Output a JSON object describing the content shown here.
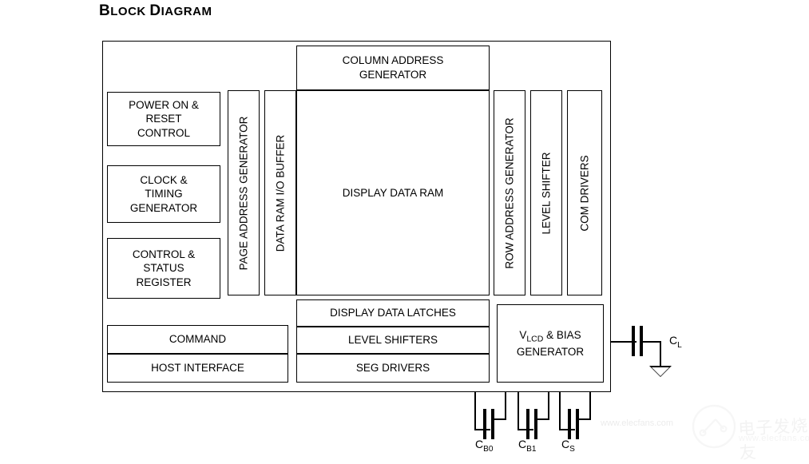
{
  "page": {
    "title_main": "B",
    "title": "Block Diagram",
    "title_parts": [
      "B",
      "LOCK ",
      "D",
      "IAGRAM"
    ]
  },
  "diagram": {
    "left_blocks": [
      {
        "label": "POWER ON &\nRESET\nCONTROL"
      },
      {
        "label": "CLOCK &\nTIMING\nGENERATOR"
      },
      {
        "label": "CONTROL &\nSTATUS\nREGISTER"
      }
    ],
    "bottom_left_blocks": [
      {
        "label": "COMMAND"
      },
      {
        "label": "HOST INTERFACE"
      }
    ],
    "vertical_blocks": [
      {
        "label": "PAGE ADDRESS GENERATOR"
      },
      {
        "label": "DATA RAM I/O BUFFER"
      },
      {
        "label": "ROW ADDRESS GENERATOR"
      },
      {
        "label": "LEVEL SHIFTER"
      },
      {
        "label": "COM DRIVERS"
      }
    ],
    "center_blocks": [
      {
        "label": "COLUMN ADDRESS\nGENERATOR"
      },
      {
        "label": "DISPLAY DATA RAM"
      },
      {
        "label": "DISPLAY DATA LATCHES"
      },
      {
        "label": "LEVEL SHIFTERS"
      },
      {
        "label": "SEG DRIVERS"
      }
    ],
    "bias_block": {
      "line1_prefix": "V",
      "line1_sub": "LCD",
      "line1_suffix": " & BIAS",
      "line2": "GENERATOR"
    },
    "capacitors": [
      {
        "name": "C",
        "sub": "L"
      },
      {
        "name": "C",
        "sub": "B0"
      },
      {
        "name": "C",
        "sub": "B1"
      },
      {
        "name": "C",
        "sub": "S"
      }
    ],
    "colors": {
      "line": "#000000",
      "background": "#ffffff"
    }
  },
  "watermark": {
    "brand": "电子发烧友",
    "url": "www.elecfans.com",
    "url_small": "www.elecfans.com"
  }
}
